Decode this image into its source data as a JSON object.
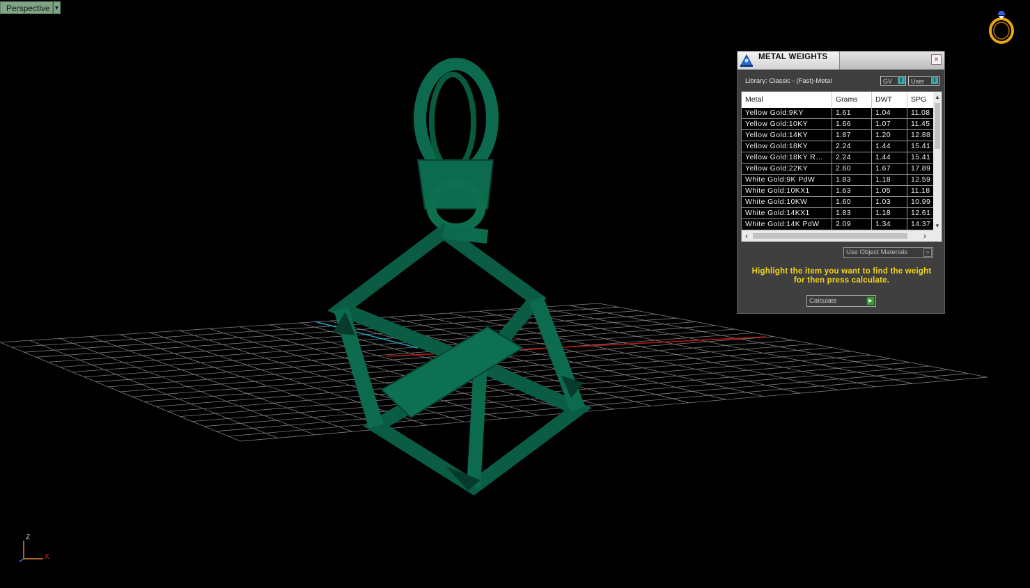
{
  "viewport": {
    "view_name": "Perspective",
    "axis_labels": {
      "z": "Z",
      "x": "X"
    },
    "model_color": "#0c6b4e",
    "grid_color": "#8c8c8c"
  },
  "metal_panel": {
    "title": "METAL WEIGHTS",
    "library": "Library: Classic - (Fast)-Metal",
    "gv_label": "GV",
    "user_label": "User",
    "columns": [
      "Metal",
      "Grams",
      "DWT",
      "SPG"
    ],
    "rows": [
      [
        "Yellow Gold:9KY",
        "1.61",
        "1.04",
        "11.08"
      ],
      [
        "Yellow Gold:10KY",
        "1.66",
        "1.07",
        "11.45"
      ],
      [
        "Yellow Gold:14KY",
        "1.87",
        "1.20",
        "12.88"
      ],
      [
        "Yellow Gold:18KY",
        "2.24",
        "1.44",
        "15.41"
      ],
      [
        "Yellow Gold:18KY R…",
        "2.24",
        "1.44",
        "15.41"
      ],
      [
        "Yellow Gold:22KY",
        "2.60",
        "1.67",
        "17.89"
      ],
      [
        "White Gold:9K PdW",
        "1.83",
        "1.18",
        "12.59"
      ],
      [
        "White Gold:10KX1",
        "1.63",
        "1.05",
        "11.18"
      ],
      [
        "White Gold:10KW",
        "1.60",
        "1.03",
        "10.99"
      ],
      [
        "White Gold:14KX1",
        "1.83",
        "1.18",
        "12.61"
      ],
      [
        "White Gold:14K PdW",
        "2.09",
        "1.34",
        "14.37"
      ]
    ],
    "use_object_materials": "Use Object Materials",
    "hint": "Highlight the item you want to find the weight for then press calculate.",
    "calculate_label": "Calculate",
    "hint_color": "#f2d51a"
  }
}
